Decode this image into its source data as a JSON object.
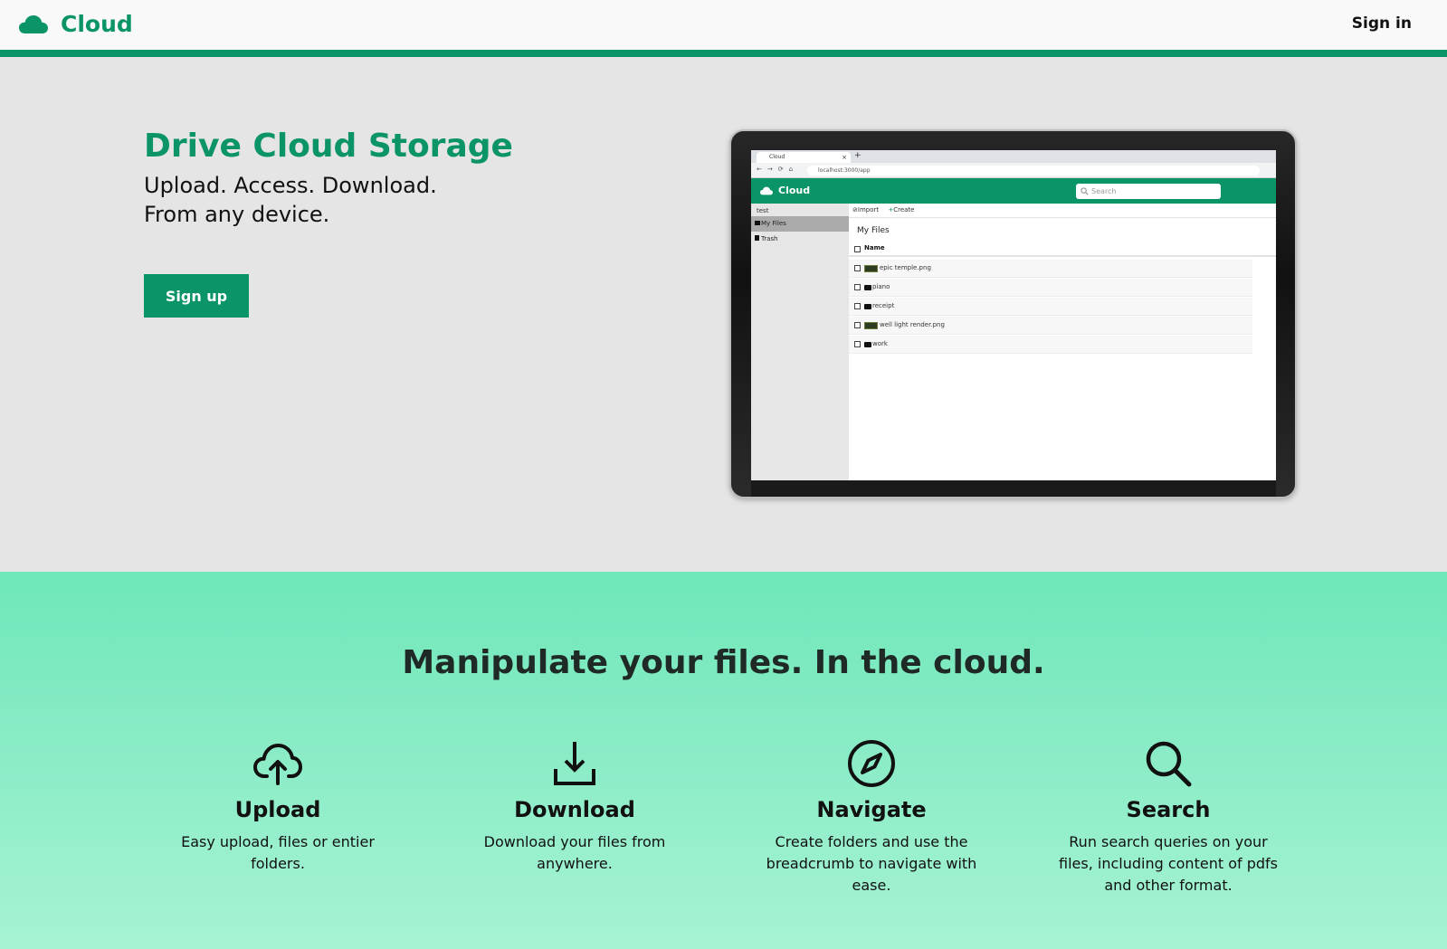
{
  "nav": {
    "brand": "Cloud",
    "sign_in": "Sign in"
  },
  "hero": {
    "title": "Drive Cloud Storage",
    "subtitle_line1": "Upload. Access. Download.",
    "subtitle_line2": "From any device.",
    "signup_label": "Sign up"
  },
  "mockup": {
    "tab_title": "Cloud",
    "tab_close": "×",
    "tab_new": "+",
    "url": "localhost:3000/app",
    "app_name": "Cloud",
    "search_placeholder": "Search",
    "user": "test",
    "sidebar_items": [
      "My Files",
      "Trash"
    ],
    "toolbar": {
      "import": "Import",
      "create": "Create"
    },
    "breadcrumb": "My Files",
    "column_name": "Name",
    "files": [
      {
        "name": "epic temple.png",
        "type": "image"
      },
      {
        "name": "piano",
        "type": "folder"
      },
      {
        "name": "receipt",
        "type": "folder"
      },
      {
        "name": "well light render.png",
        "type": "image"
      },
      {
        "name": "work",
        "type": "folder"
      }
    ]
  },
  "features": {
    "heading": "Manipulate your files. In the cloud.",
    "items": [
      {
        "icon": "cloud-upload-icon",
        "title": "Upload",
        "description": "Easy upload, files or entier folders."
      },
      {
        "icon": "download-icon",
        "title": "Download",
        "description": "Download your files from anywhere."
      },
      {
        "icon": "compass-icon",
        "title": "Navigate",
        "description": "Create folders and use the breadcrumb to navigate with ease."
      },
      {
        "icon": "search-icon",
        "title": "Search",
        "description": "Run search queries on your files, including content of pdfs and other format."
      }
    ]
  },
  "colors": {
    "brand_green": "#0a9468",
    "hero_bg": "#e5e5e5",
    "features_bg_top": "#6ee7b9",
    "features_bg_bottom": "#a6f3d3"
  }
}
